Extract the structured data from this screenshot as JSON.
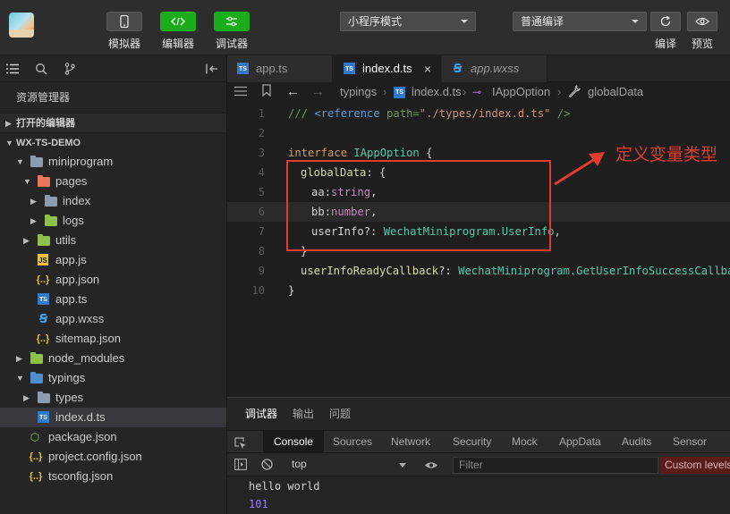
{
  "toolbar": {
    "simulator": "模拟器",
    "editor": "编辑器",
    "debugger": "调试器",
    "mode_select": "小程序模式",
    "compile_select": "普通编译",
    "compile": "编译",
    "preview": "预览",
    "colors": {
      "simulator": "#4a4a4a",
      "editor": "#1aad19",
      "debugger": "#1aad19"
    }
  },
  "sidebar": {
    "explorer_title": "资源管理器",
    "open_editors": "打开的编辑器",
    "project": "WX-TS-DEMO",
    "tree": [
      {
        "label": "miniprogram",
        "icon": "folder-icon",
        "depth": 1,
        "state": "open"
      },
      {
        "label": "pages",
        "icon": "folder-pages-icon",
        "depth": 2,
        "state": "open"
      },
      {
        "label": "index",
        "icon": "folder-icon",
        "depth": 3,
        "state": "closed"
      },
      {
        "label": "logs",
        "icon": "folder-logs-icon",
        "depth": 3,
        "state": "closed"
      },
      {
        "label": "utils",
        "icon": "folder-utils-icon",
        "depth": 2,
        "state": "closed"
      },
      {
        "label": "app.js",
        "icon": "js-file-icon",
        "depth": 2
      },
      {
        "label": "app.json",
        "icon": "json-file-icon",
        "depth": 2
      },
      {
        "label": "app.ts",
        "icon": "ts-file-icon",
        "depth": 2
      },
      {
        "label": "app.wxss",
        "icon": "css-file-icon",
        "depth": 2
      },
      {
        "label": "sitemap.json",
        "icon": "json-file-icon",
        "depth": 2
      },
      {
        "label": "node_modules",
        "icon": "folder-node-icon",
        "depth": 1,
        "state": "closed"
      },
      {
        "label": "typings",
        "icon": "folder-typings-icon",
        "depth": 1,
        "state": "open"
      },
      {
        "label": "types",
        "icon": "folder-icon",
        "depth": 2,
        "state": "closed"
      },
      {
        "label": "index.d.ts",
        "icon": "ts-file-icon",
        "depth": 2,
        "active": true
      },
      {
        "label": "package.json",
        "icon": "package-file-icon",
        "depth": 1
      },
      {
        "label": "project.config.json",
        "icon": "json-file-icon",
        "depth": 1
      },
      {
        "label": "tsconfig.json",
        "icon": "json-file-icon",
        "depth": 1
      }
    ]
  },
  "tabs": [
    {
      "label": "app.ts",
      "icon": "ts-file-icon"
    },
    {
      "label": "index.d.ts",
      "icon": "ts-file-icon",
      "active": true,
      "close": "×"
    },
    {
      "label": "app.wxss",
      "icon": "css-file-icon"
    }
  ],
  "breadcrumb": {
    "folder": "typings",
    "file": "index.d.ts",
    "interface": "IAppOption",
    "property": "globalData"
  },
  "code": {
    "line_numbers": [
      "1",
      "2",
      "3",
      "4",
      "5",
      "6",
      "7",
      "8",
      "9",
      "10"
    ],
    "l1_a": "/// ",
    "l1_b": "<reference",
    "l1_c": " path=",
    "l1_d": "\"./types/index.d.ts\"",
    "l1_e": " />",
    "l3_a": "interface ",
    "l3_b": "IAppOption",
    "l3_c": " {",
    "l4_a": "globalData",
    "l4_b": ": {",
    "l5_a": "aa",
    "l5_b": ":",
    "l5_c": "string",
    "l5_d": ",",
    "l6_a": "bb",
    "l6_b": ":",
    "l6_c": "number",
    "l6_d": ",",
    "l7_a": "userInfo",
    "l7_b": "?: ",
    "l7_c": "WechatMiniprogram.UserInfo",
    "l7_d": ",",
    "l8_a": "}",
    "l9_a": "userInfoReadyCallback",
    "l9_b": "?: ",
    "l9_c": "WechatMiniprogram.GetUserInfoSuccessCallback",
    "l9_d": ",",
    "l10_a": "}"
  },
  "annotation": {
    "text": "定义变量类型",
    "color": "#e23b2f"
  },
  "devtools": {
    "tabs": [
      "调试器",
      "输出",
      "问题"
    ],
    "panels": [
      "Console",
      "Sources",
      "Network",
      "Security",
      "Mock",
      "AppData",
      "Audits",
      "Sensor"
    ],
    "context": "top",
    "filter_placeholder": "Filter",
    "levels": "Custom levels",
    "output": [
      "hello world",
      "101"
    ]
  }
}
